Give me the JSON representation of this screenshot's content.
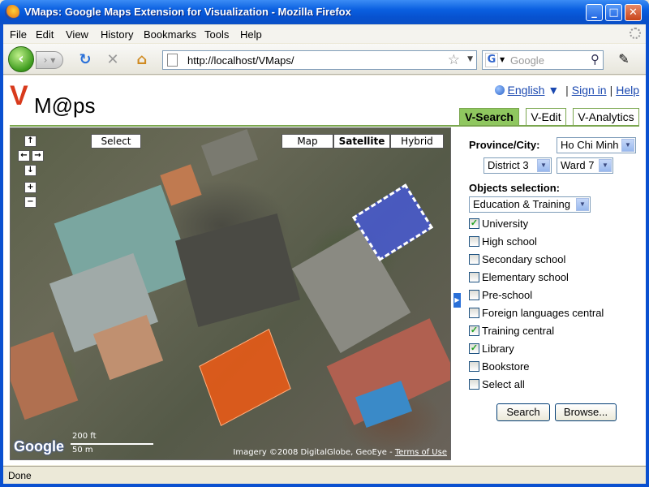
{
  "window": {
    "title": "VMaps: Google Maps Extension for Visualization - Mozilla Firefox",
    "controls": {
      "minimize": "_",
      "maximize": "□",
      "close": "✕"
    }
  },
  "menu": [
    "File",
    "Edit",
    "View",
    "History",
    "Bookmarks",
    "Tools",
    "Help"
  ],
  "nav": {
    "url": "http://localhost/VMaps/",
    "search_placeholder": "Google",
    "search_engine_letter": "G"
  },
  "app": {
    "logo_v": "V",
    "logo_text": "M@ps",
    "language": "English",
    "signin": "Sign in",
    "help": "Help",
    "separator": "|",
    "tabs": [
      {
        "label": "V-Search",
        "active": true
      },
      {
        "label": "V-Edit",
        "active": false
      },
      {
        "label": "V-Analytics",
        "active": false
      }
    ]
  },
  "map": {
    "select_label": "Select",
    "types": [
      {
        "label": "Map",
        "active": false
      },
      {
        "label": "Satellite",
        "active": true
      },
      {
        "label": "Hybrid",
        "active": false
      }
    ],
    "controls": {
      "up": "↑",
      "left": "←",
      "right": "→",
      "down": "↓",
      "zoom_in": "+",
      "zoom_out": "−"
    },
    "scale_top": "200 ft",
    "scale_bottom": "50 m",
    "google_logo": "Google",
    "copyright": "Imagery ©2008 DigitalGlobe, GeoEye - ",
    "terms": "Terms of Use"
  },
  "panel": {
    "province_label": "Province/City:",
    "province_value": "Ho Chi Minh",
    "district_value": "District 3",
    "ward_value": "Ward 7",
    "objects_label": "Objects selection:",
    "category_value": "Education & Training",
    "checkboxes": [
      {
        "label": "University",
        "checked": true
      },
      {
        "label": "High school",
        "checked": false
      },
      {
        "label": "Secondary school",
        "checked": false
      },
      {
        "label": "Elementary school",
        "checked": false
      },
      {
        "label": "Pre-school",
        "checked": false
      },
      {
        "label": "Foreign languages central",
        "checked": false
      },
      {
        "label": "Training central",
        "checked": true
      },
      {
        "label": "Library",
        "checked": true
      },
      {
        "label": "Bookstore",
        "checked": false
      },
      {
        "label": "Select all",
        "checked": false
      }
    ],
    "search_button": "Search",
    "browse_button": "Browse..."
  },
  "status": "Done",
  "colors": {
    "tab_active": "#8fc75f",
    "link": "#1a48b0",
    "blue_polygon": "#465ae6",
    "orange_polygon": "#f05a14"
  }
}
